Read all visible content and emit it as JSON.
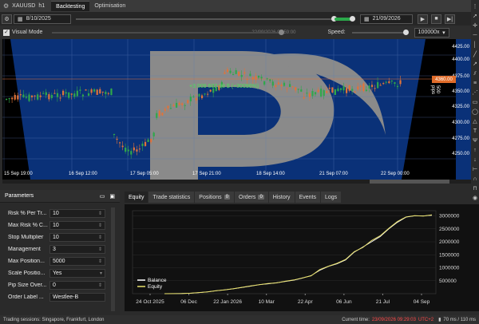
{
  "header": {
    "symbol": "XAUUSD",
    "timeframe": "h1",
    "tabs": [
      {
        "label": "Backtesting",
        "active": true
      },
      {
        "label": "Optimisation",
        "active": false
      }
    ]
  },
  "controls": {
    "start_date": "8/10/2025",
    "end_date": "21/09/2026",
    "progress_fraction": 1.0,
    "visual_mode_label": "Visual Mode",
    "visual_mode_checked": true,
    "current_datetime": "22/09/2026 01:59:00",
    "speed_label": "Speed:",
    "speed_value": "100000x"
  },
  "chart": {
    "equity_text": "+3 009 602.98 $ (+30096%)",
    "price_tag": "4360.00",
    "vertical_text": "500 pips",
    "accent_up": "#e0733a",
    "accent_down": "#2fa84a",
    "y_ticks": [
      "4425.00",
      "4400.00",
      "4375.00",
      "4350.00",
      "4325.00",
      "4300.00",
      "4275.00",
      "4250.00"
    ],
    "x_ticks": [
      "15 Sep 19:00",
      "16 Sep 12:00",
      "17 Sep 05:00",
      "17 Sep 21:00",
      "18 Sep 14:00",
      "21 Sep 07:00",
      "22 Sep 00:00"
    ]
  },
  "parameters": {
    "title": "Parameters",
    "rows": [
      {
        "label": "Risk % Per Tr...",
        "value": "10"
      },
      {
        "label": "Max Risk % C...",
        "value": "10"
      },
      {
        "label": "Stop Multiplier",
        "value": "10"
      },
      {
        "label": "Management",
        "value": "3"
      },
      {
        "label": "Max Position...",
        "value": "5000"
      },
      {
        "label": "Scale Positio...",
        "value": "Yes"
      },
      {
        "label": "Pip Size Over...",
        "value": "0"
      },
      {
        "label": "Order Label ...",
        "value": "Westlee-B"
      }
    ]
  },
  "bottom_tabs": [
    {
      "label": "Equity",
      "active": true,
      "badge": ""
    },
    {
      "label": "Trade statistics",
      "active": false,
      "badge": ""
    },
    {
      "label": "Positions",
      "active": false,
      "badge": "0"
    },
    {
      "label": "Orders",
      "active": false,
      "badge": "0"
    },
    {
      "label": "History",
      "active": false,
      "badge": ""
    },
    {
      "label": "Events",
      "active": false,
      "badge": ""
    },
    {
      "label": "Logs",
      "active": false,
      "badge": ""
    }
  ],
  "chart_data": {
    "type": "line",
    "x_labels": [
      "24 Oct 2025",
      "06 Dec",
      "22 Jan 2026",
      "10 Mar",
      "22 Apr",
      "06 Jun",
      "21 Jul",
      "04 Sep"
    ],
    "y_ticks": [
      "3000000",
      "2500000",
      "2000000",
      "1500000",
      "1000000",
      "500000"
    ],
    "ylim": [
      0,
      3200000
    ],
    "legend": [
      "Balance",
      "Equity"
    ],
    "legend_position": "bottom-left",
    "series": [
      {
        "name": "Balance",
        "color": "#ffffff",
        "values": [
          0,
          2000,
          5000,
          15000,
          40000,
          70000,
          110000,
          150000,
          190000,
          240000,
          290000,
          350000,
          380000,
          420000,
          470000,
          520000,
          600000,
          700000,
          900000,
          1050000,
          1150000,
          1300000,
          1600000,
          1800000,
          2000000,
          2200000,
          2500000,
          2750000,
          2950000,
          3000000,
          3000000,
          3020000
        ]
      },
      {
        "name": "Equity",
        "color": "#e8e06a",
        "values": [
          0,
          2000,
          6000,
          18000,
          42000,
          68000,
          115000,
          148000,
          195000,
          245000,
          300000,
          345000,
          390000,
          415000,
          480000,
          530000,
          610000,
          690000,
          930000,
          1060000,
          1170000,
          1320000,
          1620000,
          1780000,
          2050000,
          2230000,
          2520000,
          2780000,
          2960000,
          3010000,
          2990000,
          3040000
        ]
      }
    ]
  },
  "status": {
    "sessions": "Trading sessions: Singapore, Frankfurt, London",
    "current_time_label": "Current time:",
    "current_time": "23/09/2026 09:29:03",
    "utc": "UTC+2",
    "latency": "70 ms / 110 ms"
  }
}
